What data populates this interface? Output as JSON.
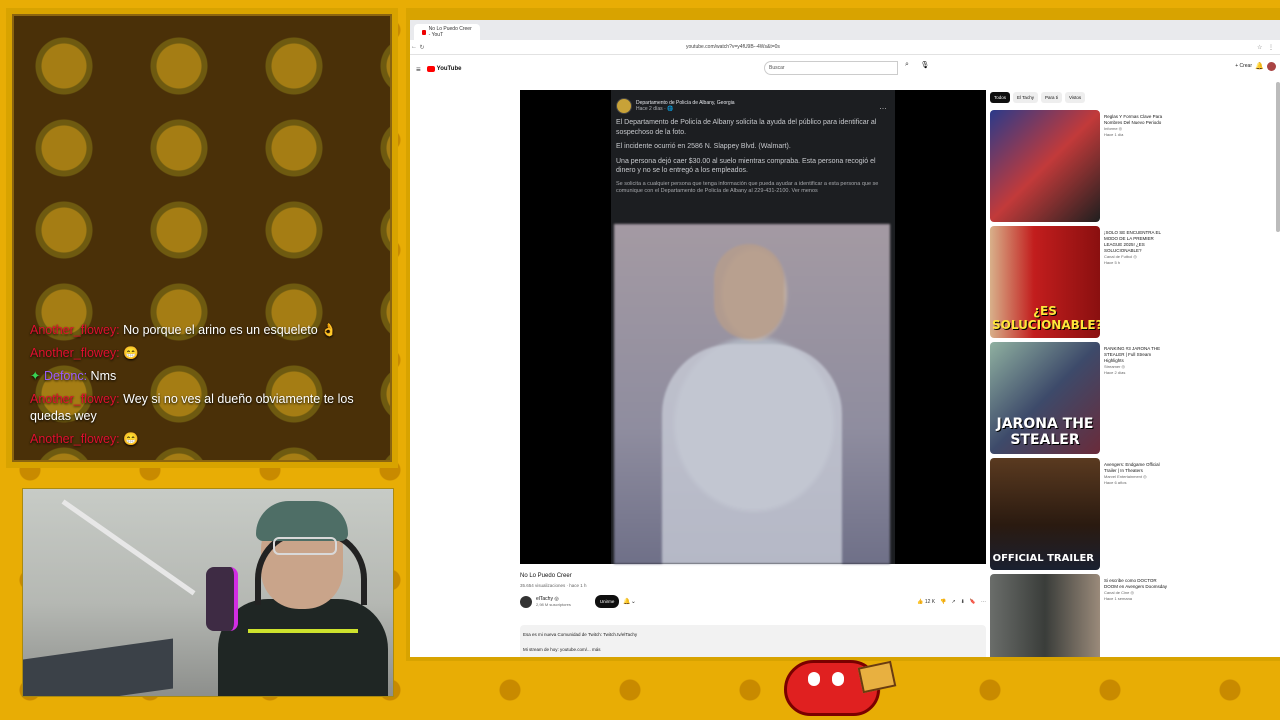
{
  "chat": {
    "messages": [
      {
        "user": "Another_flowey:",
        "text": "No porque el arino es un esqueleto 👌",
        "color": "#e0102f"
      },
      {
        "user": "Another_flowey:",
        "text": "😁",
        "color": "#e0102f"
      },
      {
        "badge": "✦",
        "user": "Defonc:",
        "text": "Nms",
        "color": "#9b5cff"
      },
      {
        "user": "Another_flowey:",
        "text": "Wey si no ves al dueño obviamente te los quedas wey",
        "color": "#e0102f"
      },
      {
        "user": "Another_flowey:",
        "text": "😁",
        "color": "#e0102f"
      }
    ]
  },
  "browser": {
    "tab_title": "No Lo Puedo Creer - YouT",
    "url": "youtube.com/watch?v=y4fU9B--4Ws&t=0s",
    "search_placeholder": "Buscar",
    "logo_text": "YouTube",
    "create_label": "+ Crear"
  },
  "post": {
    "author": "Departamento de Policía de Albany, Georgia",
    "time": "Hace 2 días · 🌐",
    "paragraphs": [
      "El Departamento de Policía de Albany solicita la ayuda del público para identificar al sospechoso de la foto.",
      "El incidente ocurrió en 2586 N. Slappey Blvd. (Walmart).",
      "Una persona dejó caer $30.00 al suelo mientras compraba. Esta persona recogió el dinero y no se lo entregó a los empleados."
    ],
    "small": "Se solicita a cualquier persona que tenga información que pueda ayudar a identificar a esta persona que se comunique con el Departamento de Policía de Albany al 229-431-2100. Ver menos"
  },
  "video": {
    "title": "No Lo Puedo Creer",
    "meta": "35.654 visualizaciones · hace 1 h",
    "channel": "elTachy ◎",
    "subs": "2,98 M suscriptores",
    "subscribe": "Unirme",
    "likes": "👍 12 K",
    "description_line1": "Esa es mi nueva Comunidad de Twitch: Twitch.tv/elTachy",
    "description_line2": "Mi stream de hoy: youtube.com/... más"
  },
  "chips": [
    "Todos",
    "El Tachy",
    "Para ti",
    "Vistos"
  ],
  "recommendations": [
    {
      "title": "Reglas Y Formas Clave Para Nombres Del Nuevo Periodo",
      "channel": "Informe ◎",
      "meta": "Hace 1 día",
      "thumb_text": "",
      "bg": "#2b3a8a"
    },
    {
      "title": "¡SOLO SE ENCUENTRA EL MODO DE LA PREMIER LEAGUE 2025! ¿ES SOLUCIONABLE?",
      "channel": "Canal de Futbol ◎",
      "meta": "Hace 5 h",
      "thumb_text": "¿ES SOLUCIONABLE?",
      "bg": "#b01a1a"
    },
    {
      "title": "RANKING #3 JARONA THE STEALER | Full Stream Highlights",
      "channel": "Streamer ◎",
      "meta": "Hace 2 días",
      "thumb_text": "JARONA THE STEALER",
      "bg": "#3d4a6a"
    },
    {
      "title": "Avengers: Endgame Official Trailer | In Theaters",
      "channel": "Marvel Entertainment ◎",
      "meta": "Hace 6 años",
      "thumb_text": "OFFICIAL TRAILER",
      "bg": "#3a2a1a"
    },
    {
      "title": "Si escribe como DOCTOR DOOM en Avengers Doomsday",
      "channel": "Canal de Cine ◎",
      "meta": "Hace 1 semana",
      "thumb_text": "",
      "bg": "#4a4d4a"
    }
  ]
}
